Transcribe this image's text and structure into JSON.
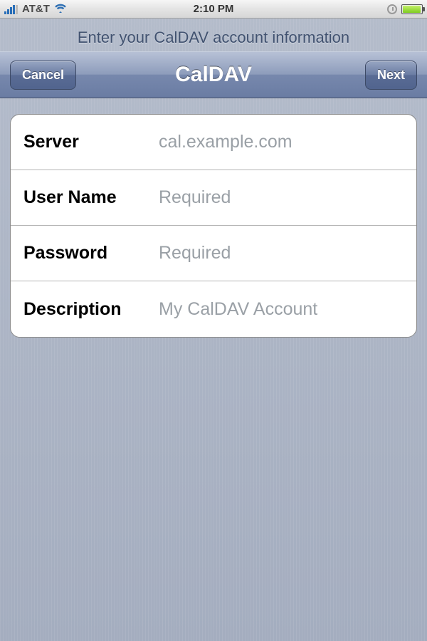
{
  "status": {
    "carrier": "AT&T",
    "time": "2:10 PM"
  },
  "header": {
    "instruction": "Enter your CalDAV account information",
    "cancel_label": "Cancel",
    "title": "CalDAV",
    "next_label": "Next"
  },
  "form": {
    "server": {
      "label": "Server",
      "placeholder": "cal.example.com",
      "value": ""
    },
    "username": {
      "label": "User Name",
      "placeholder": "Required",
      "value": ""
    },
    "password": {
      "label": "Password",
      "placeholder": "Required",
      "value": ""
    },
    "description": {
      "label": "Description",
      "placeholder": "My CalDAV Account",
      "value": ""
    }
  }
}
